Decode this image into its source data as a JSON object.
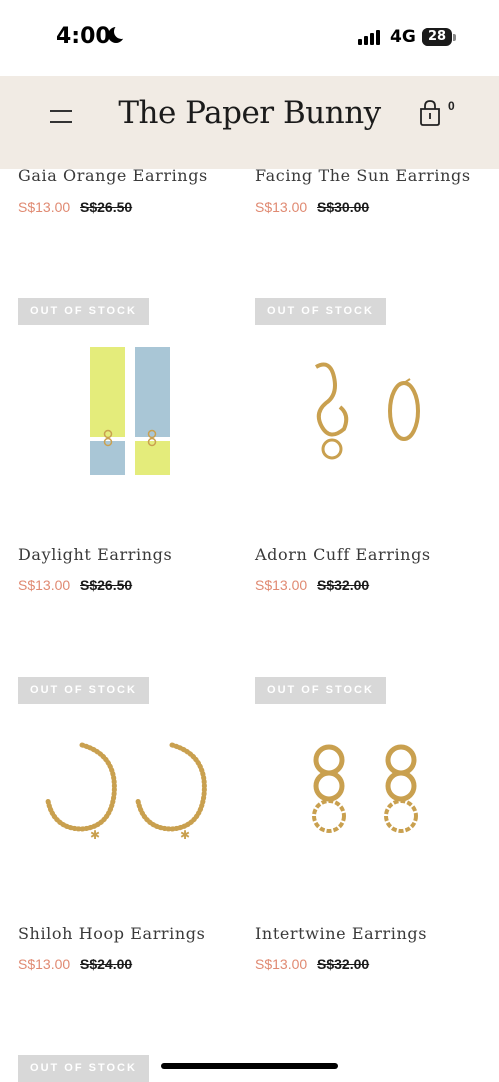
{
  "status": {
    "time": "4:00",
    "network": "4G",
    "battery": "28"
  },
  "header": {
    "brand": "The Paper Bunny",
    "cart_count": "0"
  },
  "badge_text": "OUT OF STOCK",
  "products": [
    {
      "title": "Gaia Orange Earrings",
      "price": "S$13.00",
      "original": "S$26.50",
      "image_icon": "gaia-orange-earrings-image"
    },
    {
      "title": "Facing The Sun Earrings",
      "price": "S$13.00",
      "original": "S$30.00",
      "image_icon": "facing-the-sun-earrings-image"
    },
    {
      "title": "Daylight Earrings",
      "price": "S$13.00",
      "original": "S$26.50",
      "out_of_stock": true,
      "image_icon": "daylight-earrings-image"
    },
    {
      "title": "Adorn Cuff Earrings",
      "price": "S$13.00",
      "original": "S$32.00",
      "out_of_stock": true,
      "image_icon": "adorn-cuff-earrings-image"
    },
    {
      "title": "Shiloh Hoop Earrings",
      "price": "S$13.00",
      "original": "S$24.00",
      "out_of_stock": true,
      "image_icon": "shiloh-hoop-earrings-image"
    },
    {
      "title": "Intertwine Earrings",
      "price": "S$13.00",
      "original": "S$32.00",
      "out_of_stock": true,
      "image_icon": "intertwine-earrings-image"
    }
  ],
  "colors": {
    "sale_price": "#e08a72",
    "header_bg": "#f1ebe4",
    "badge_bg": "#d8d8d8",
    "gold": "#c9a04f"
  }
}
